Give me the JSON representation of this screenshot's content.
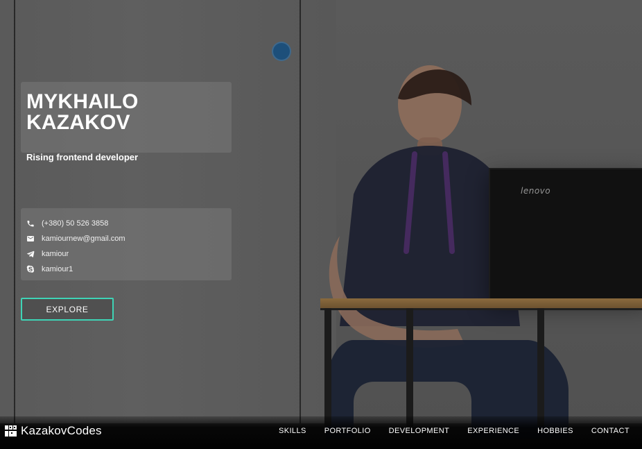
{
  "hero": {
    "name": "MYKHAILO KAZAKOV",
    "subtitle": "Rising frontend developer"
  },
  "background": {
    "laptop_brand": "lenovo"
  },
  "contacts": [
    {
      "icon": "phone-icon",
      "text": "(+380) 50 526 3858"
    },
    {
      "icon": "mail-icon",
      "text": "kamiournew@gmail.com"
    },
    {
      "icon": "telegram-icon",
      "text": "kamiour"
    },
    {
      "icon": "skype-icon",
      "text": "kamiour1"
    }
  ],
  "cta": {
    "explore_label": "EXPLORE"
  },
  "nav": {
    "brand": "KazakovCodes",
    "links": [
      "SKILLS",
      "PORTFOLIO",
      "DEVELOPMENT",
      "EXPERIENCE",
      "HOBBIES",
      "CONTACT"
    ]
  },
  "colors": {
    "accent": "#3ed4b6",
    "card_bg": "rgba(120,120,120,0.55)",
    "text": "#ffffff"
  }
}
